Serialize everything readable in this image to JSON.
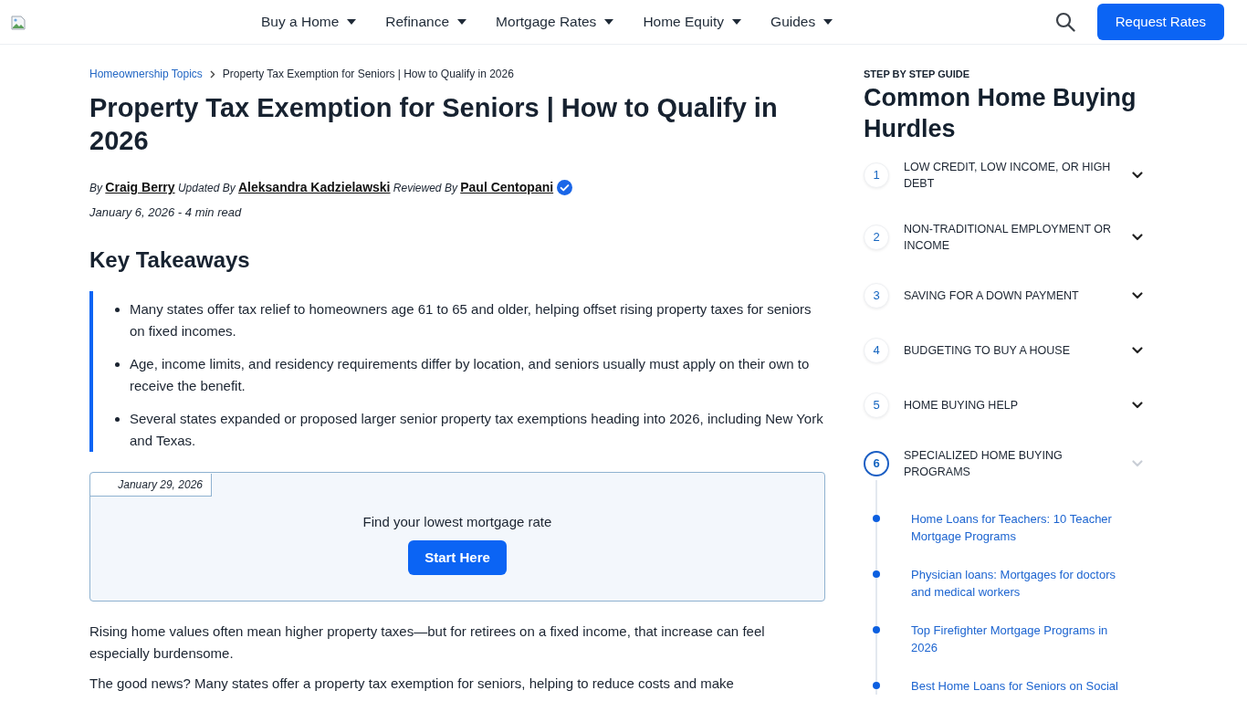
{
  "header": {
    "nav": [
      "Buy a Home",
      "Refinance",
      "Mortgage Rates",
      "Home Equity",
      "Guides"
    ],
    "button": "Request Rates"
  },
  "breadcrumb": [
    {
      "label": "Homeownership Topics",
      "current": false
    },
    {
      "label": "Property Tax Exemption for Seniors | How to Qualify in 2026",
      "current": true
    }
  ],
  "article": {
    "title": "Property Tax Exemption for Seniors | How to Qualify in 2026",
    "byline": [
      {
        "role": "By",
        "name": "Craig Berry",
        "verified": false
      },
      {
        "role": "Updated By",
        "name": "Aleksandra Kadzielawski",
        "verified": false
      },
      {
        "role": "Reviewed By",
        "name": "Paul Centopani",
        "verified": true
      }
    ],
    "meta": "January 6, 2026 - 4 min read",
    "takeaways": {
      "heading": "Key Takeaways",
      "items": [
        "Many states offer tax relief to homeowners age 61 to 65 and older, helping offset rising property taxes for seniors on fixed incomes.",
        "Age, income limits, and residency requirements differ by location, and seniors usually must apply on their own to receive the benefit.",
        "Several states expanded or proposed larger senior property tax exemptions heading into 2026, including New York and Texas."
      ]
    },
    "rate_box": {
      "date": "January 29, 2026",
      "prompt": "Find your lowest mortgage rate",
      "button": "Start Here"
    },
    "paragraphs": [
      "Rising home values often mean higher property taxes—but for retirees on a fixed income, that increase can feel especially burdensome.",
      "The good news? Many states offer a property tax exemption for seniors, helping to reduce costs and make"
    ]
  },
  "guide": {
    "eyebrow": "STEP BY STEP GUIDE",
    "title": "Common Home Buying Hurdles",
    "steps": [
      {
        "number": "1",
        "label": "LOW CREDIT, LOW INCOME, OR HIGH DEBT",
        "expanded": false
      },
      {
        "number": "2",
        "label": "NON-TRADITIONAL EMPLOYMENT OR INCOME",
        "expanded": false
      },
      {
        "number": "3",
        "label": "SAVING FOR A DOWN PAYMENT",
        "expanded": false
      },
      {
        "number": "4",
        "label": "BUDGETING TO BUY A HOUSE",
        "expanded": false
      },
      {
        "number": "5",
        "label": "HOME BUYING HELP",
        "expanded": false
      },
      {
        "number": "6",
        "label": "SPECIALIZED HOME BUYING PROGRAMS",
        "expanded": true,
        "links": [
          "Home Loans for Teachers: 10 Teacher Mortgage Programs",
          "Physician loans: Mortgages for doctors and medical workers",
          "Top Firefighter Mortgage Programs in 2026",
          "Best Home Loans for Seniors on Social"
        ]
      }
    ]
  }
}
